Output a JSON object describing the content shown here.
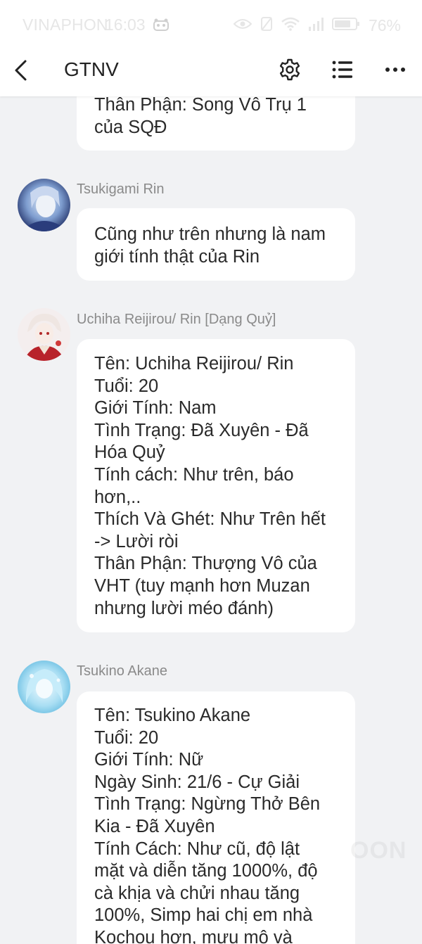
{
  "status_bar": {
    "carrier": "VINAPHON",
    "time": "16:03",
    "battery": "76%"
  },
  "header": {
    "title": "GTNV",
    "icons": [
      "back-arrow-icon",
      "gear-icon",
      "list-icon",
      "more-icon"
    ]
  },
  "messages": [
    {
      "lines": [
        "Thân Phận: Song Vô Trụ 1",
        "của SQĐ"
      ]
    },
    {
      "sender": "Tsukigami Rin",
      "lines": [
        "Cũng như trên nhưng là nam",
        "giới tính thật của Rin"
      ]
    },
    {
      "sender": "Uchiha Reijirou/ Rin [Dạng Quỷ]",
      "lines": [
        "Tên: Uchiha Reijirou/ Rin",
        "Tuổi: 20",
        "Giới Tính: Nam",
        "Tình Trạng: Đã Xuyên - Đã",
        "Hóa Quỷ",
        "Tính cách: Như trên, báo",
        "hơn,..",
        "Thích Và Ghét: Như Trên hết",
        "-> Lười ròi",
        "Thân Phận: Thượng Vô của",
        "VHT (tuy mạnh hơn Muzan",
        "nhưng lười méo đánh)"
      ]
    },
    {
      "sender": "Tsukino Akane",
      "lines": [
        "Tên: Tsukino Akane",
        "Tuổi: 20",
        "Giới Tính: Nữ",
        "Ngày Sinh: 21/6 - Cự Giải",
        "Tình Trạng: Ngừng Thở Bên",
        "Kia - Đã Xuyên",
        "Tính Cách: Như cũ, độ lật",
        "mặt và diễn tăng 1000%, độ",
        "cà khịa và chửi nhau tăng",
        "100%, Simp hai chị em nhà",
        "Kochou hơn, mưu mô và"
      ]
    }
  ],
  "watermark": "OON",
  "colors": {
    "background": "#f1f2f4",
    "bubble": "#ffffff",
    "text": "#2a2a2a",
    "sender": "#8a8a8a"
  }
}
